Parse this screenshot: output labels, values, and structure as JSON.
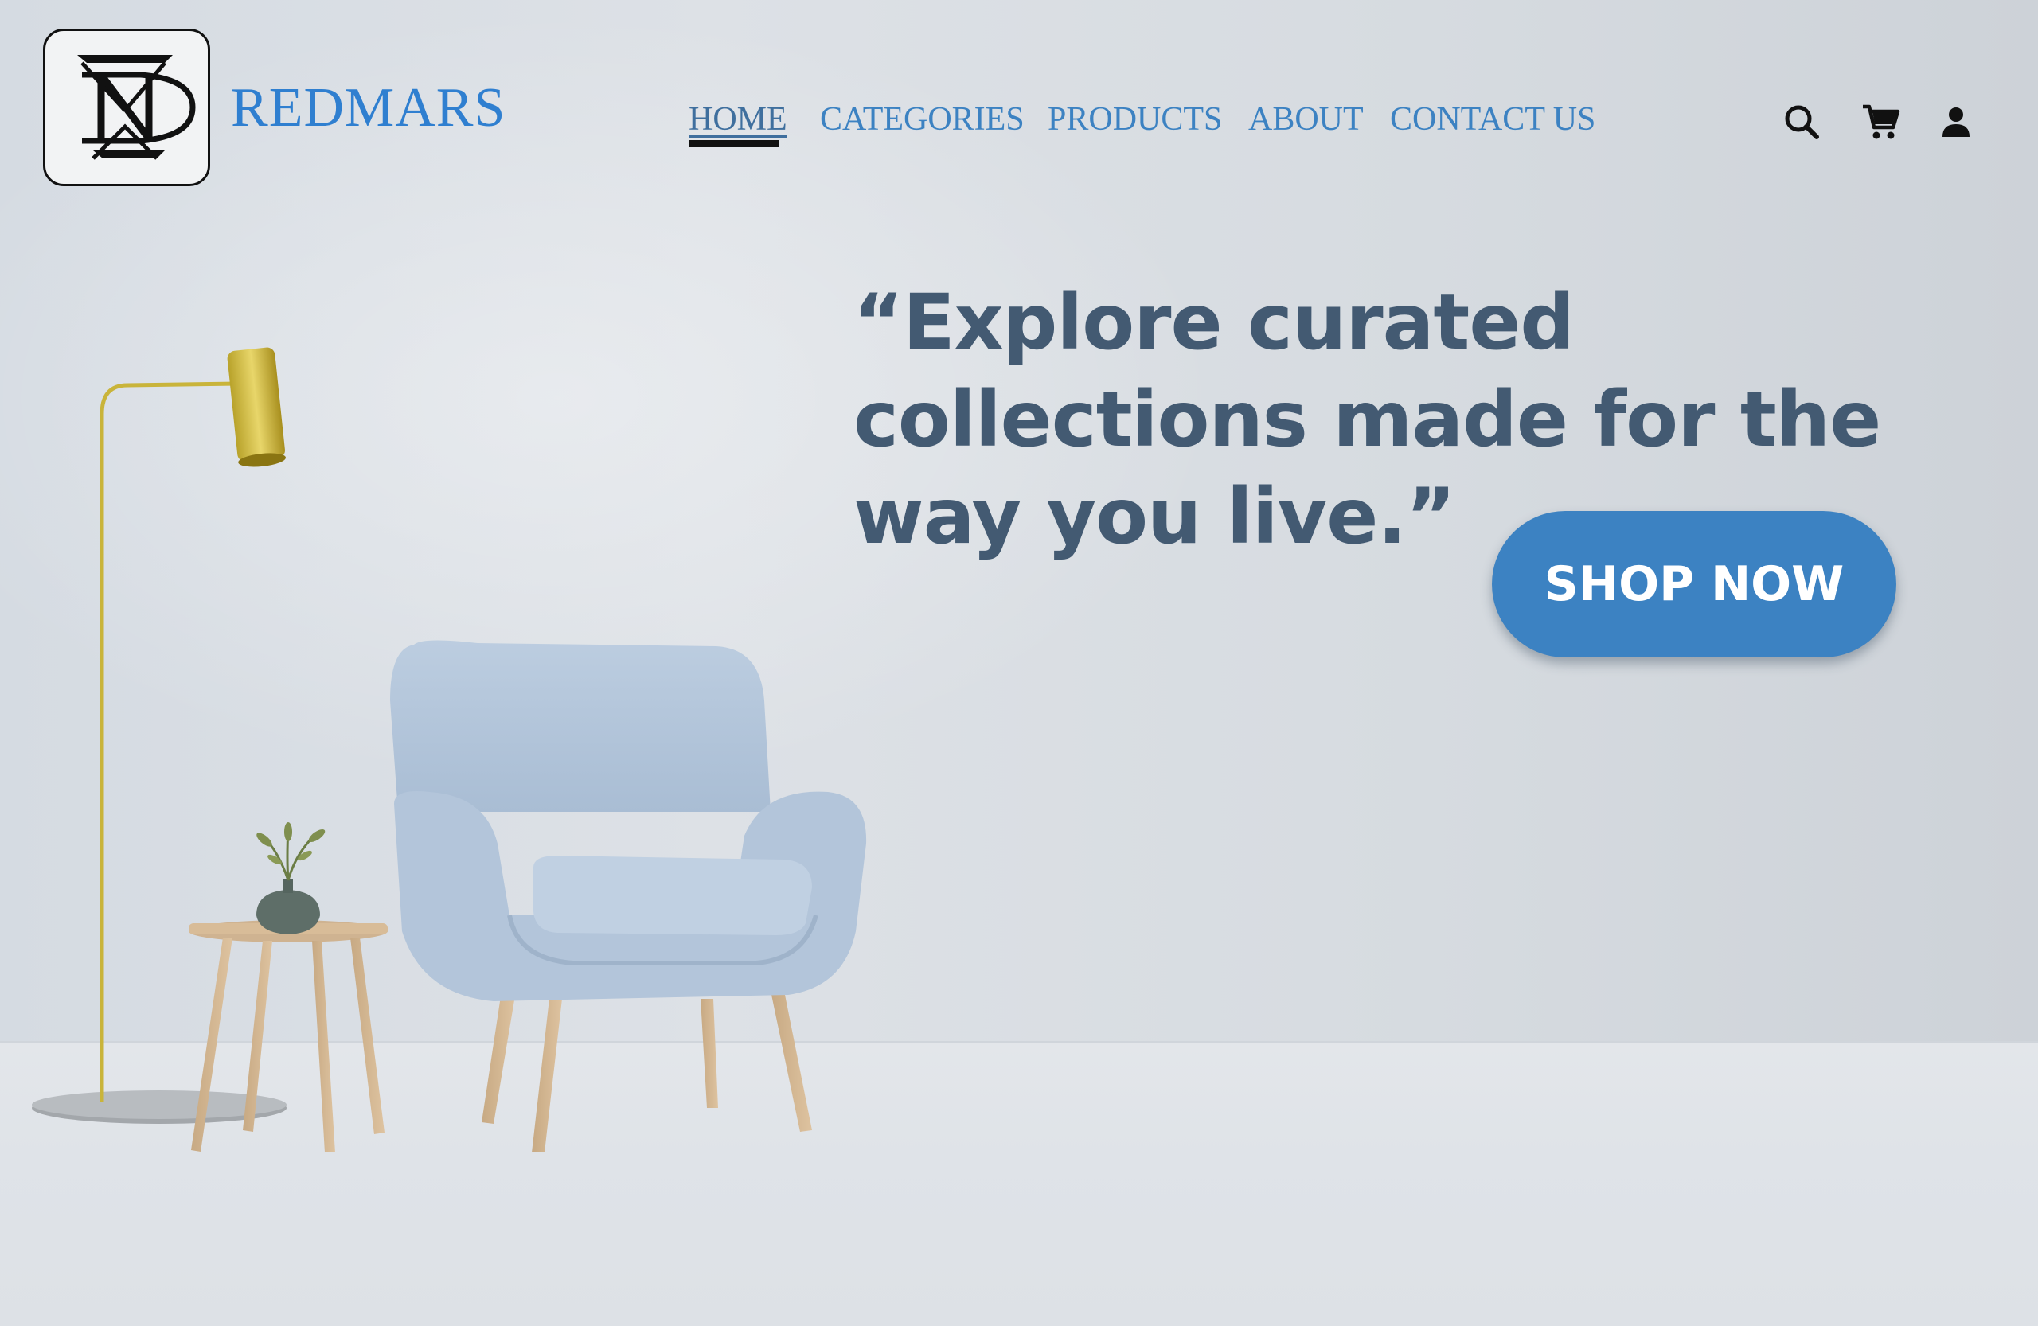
{
  "brand": {
    "name": "REDMARS",
    "logo_icon": "nd-monogram-logo"
  },
  "nav": {
    "items": [
      {
        "label": "HOME",
        "active": true
      },
      {
        "label": "CATEGORIES",
        "active": false
      },
      {
        "label": "PRODUCTS",
        "active": false
      },
      {
        "label": "ABOUT",
        "active": false
      },
      {
        "label": "CONTACT US",
        "active": false
      }
    ]
  },
  "header_icons": [
    "search-icon",
    "cart-icon",
    "account-icon"
  ],
  "hero": {
    "headline": "“Explore curated collections made for the way you live.”",
    "cta_label": "SHOP NOW"
  },
  "colors": {
    "accent": "#3c82c2",
    "brand_text": "#2f7fd0",
    "headline": "#435a72",
    "background": "#d3d8de"
  }
}
